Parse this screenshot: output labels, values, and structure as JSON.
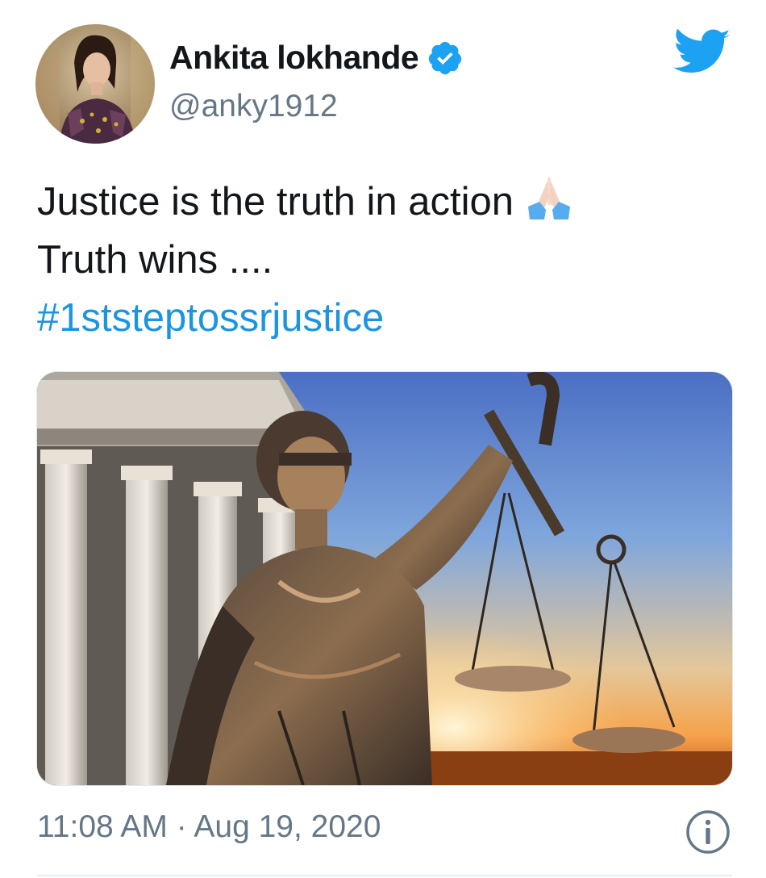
{
  "tweet": {
    "author": {
      "display_name": "Ankita lokhande",
      "handle": "@anky1912",
      "verified": true,
      "avatar_icon": "profile-photo"
    },
    "text_lines": [
      "Justice is the truth in action",
      "Truth wins ...."
    ],
    "emoji": "folded-hands-icon",
    "hashtag": "#1ststeptossrjustice",
    "media": {
      "type": "photo",
      "subject": "statue-of-lady-justice"
    },
    "timestamp": "11:08 AM · Aug 19, 2020",
    "brand_icon": "twitter-bird-icon"
  },
  "colors": {
    "twitter_blue": "#1da1f2",
    "link_blue": "#1b95e0",
    "text": "#14171a",
    "secondary": "#657786"
  }
}
